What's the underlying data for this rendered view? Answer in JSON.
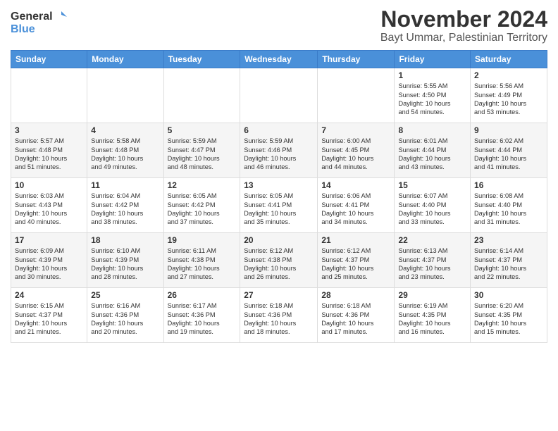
{
  "logo": {
    "general": "General",
    "blue": "Blue"
  },
  "title": "November 2024",
  "location": "Bayt Ummar, Palestinian Territory",
  "days_header": [
    "Sunday",
    "Monday",
    "Tuesday",
    "Wednesday",
    "Thursday",
    "Friday",
    "Saturday"
  ],
  "weeks": [
    [
      {
        "day": "",
        "content": ""
      },
      {
        "day": "",
        "content": ""
      },
      {
        "day": "",
        "content": ""
      },
      {
        "day": "",
        "content": ""
      },
      {
        "day": "",
        "content": ""
      },
      {
        "day": "1",
        "content": "Sunrise: 5:55 AM\nSunset: 4:50 PM\nDaylight: 10 hours\nand 54 minutes."
      },
      {
        "day": "2",
        "content": "Sunrise: 5:56 AM\nSunset: 4:49 PM\nDaylight: 10 hours\nand 53 minutes."
      }
    ],
    [
      {
        "day": "3",
        "content": "Sunrise: 5:57 AM\nSunset: 4:48 PM\nDaylight: 10 hours\nand 51 minutes."
      },
      {
        "day": "4",
        "content": "Sunrise: 5:58 AM\nSunset: 4:48 PM\nDaylight: 10 hours\nand 49 minutes."
      },
      {
        "day": "5",
        "content": "Sunrise: 5:59 AM\nSunset: 4:47 PM\nDaylight: 10 hours\nand 48 minutes."
      },
      {
        "day": "6",
        "content": "Sunrise: 5:59 AM\nSunset: 4:46 PM\nDaylight: 10 hours\nand 46 minutes."
      },
      {
        "day": "7",
        "content": "Sunrise: 6:00 AM\nSunset: 4:45 PM\nDaylight: 10 hours\nand 44 minutes."
      },
      {
        "day": "8",
        "content": "Sunrise: 6:01 AM\nSunset: 4:44 PM\nDaylight: 10 hours\nand 43 minutes."
      },
      {
        "day": "9",
        "content": "Sunrise: 6:02 AM\nSunset: 4:44 PM\nDaylight: 10 hours\nand 41 minutes."
      }
    ],
    [
      {
        "day": "10",
        "content": "Sunrise: 6:03 AM\nSunset: 4:43 PM\nDaylight: 10 hours\nand 40 minutes."
      },
      {
        "day": "11",
        "content": "Sunrise: 6:04 AM\nSunset: 4:42 PM\nDaylight: 10 hours\nand 38 minutes."
      },
      {
        "day": "12",
        "content": "Sunrise: 6:05 AM\nSunset: 4:42 PM\nDaylight: 10 hours\nand 37 minutes."
      },
      {
        "day": "13",
        "content": "Sunrise: 6:05 AM\nSunset: 4:41 PM\nDaylight: 10 hours\nand 35 minutes."
      },
      {
        "day": "14",
        "content": "Sunrise: 6:06 AM\nSunset: 4:41 PM\nDaylight: 10 hours\nand 34 minutes."
      },
      {
        "day": "15",
        "content": "Sunrise: 6:07 AM\nSunset: 4:40 PM\nDaylight: 10 hours\nand 33 minutes."
      },
      {
        "day": "16",
        "content": "Sunrise: 6:08 AM\nSunset: 4:40 PM\nDaylight: 10 hours\nand 31 minutes."
      }
    ],
    [
      {
        "day": "17",
        "content": "Sunrise: 6:09 AM\nSunset: 4:39 PM\nDaylight: 10 hours\nand 30 minutes."
      },
      {
        "day": "18",
        "content": "Sunrise: 6:10 AM\nSunset: 4:39 PM\nDaylight: 10 hours\nand 28 minutes."
      },
      {
        "day": "19",
        "content": "Sunrise: 6:11 AM\nSunset: 4:38 PM\nDaylight: 10 hours\nand 27 minutes."
      },
      {
        "day": "20",
        "content": "Sunrise: 6:12 AM\nSunset: 4:38 PM\nDaylight: 10 hours\nand 26 minutes."
      },
      {
        "day": "21",
        "content": "Sunrise: 6:12 AM\nSunset: 4:37 PM\nDaylight: 10 hours\nand 25 minutes."
      },
      {
        "day": "22",
        "content": "Sunrise: 6:13 AM\nSunset: 4:37 PM\nDaylight: 10 hours\nand 23 minutes."
      },
      {
        "day": "23",
        "content": "Sunrise: 6:14 AM\nSunset: 4:37 PM\nDaylight: 10 hours\nand 22 minutes."
      }
    ],
    [
      {
        "day": "24",
        "content": "Sunrise: 6:15 AM\nSunset: 4:37 PM\nDaylight: 10 hours\nand 21 minutes."
      },
      {
        "day": "25",
        "content": "Sunrise: 6:16 AM\nSunset: 4:36 PM\nDaylight: 10 hours\nand 20 minutes."
      },
      {
        "day": "26",
        "content": "Sunrise: 6:17 AM\nSunset: 4:36 PM\nDaylight: 10 hours\nand 19 minutes."
      },
      {
        "day": "27",
        "content": "Sunrise: 6:18 AM\nSunset: 4:36 PM\nDaylight: 10 hours\nand 18 minutes."
      },
      {
        "day": "28",
        "content": "Sunrise: 6:18 AM\nSunset: 4:36 PM\nDaylight: 10 hours\nand 17 minutes."
      },
      {
        "day": "29",
        "content": "Sunrise: 6:19 AM\nSunset: 4:35 PM\nDaylight: 10 hours\nand 16 minutes."
      },
      {
        "day": "30",
        "content": "Sunrise: 6:20 AM\nSunset: 4:35 PM\nDaylight: 10 hours\nand 15 minutes."
      }
    ]
  ]
}
